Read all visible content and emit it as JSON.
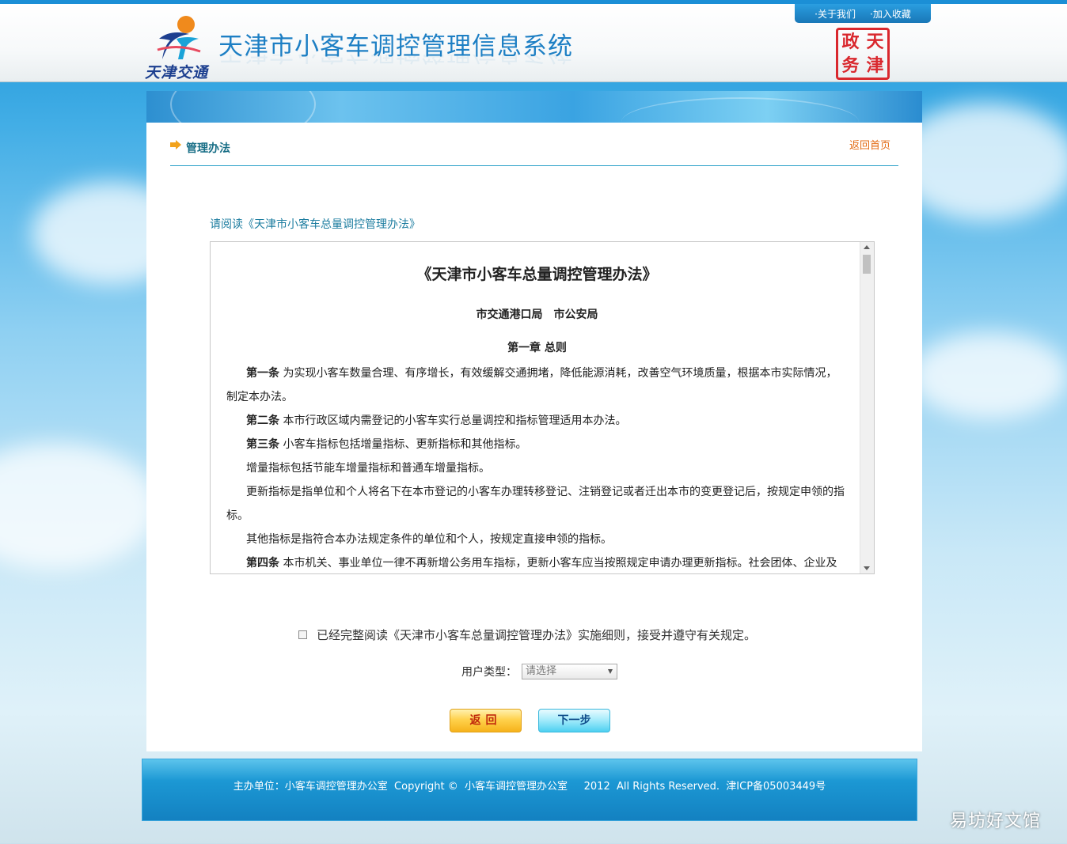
{
  "header": {
    "logo_sub": "天津交通",
    "site_title": "天津市小客车调控管理信息系统",
    "top_links": [
      "·关于我们",
      "·加入收藏"
    ],
    "seal_chars": [
      "天",
      "津",
      "政",
      "务"
    ]
  },
  "section": {
    "title": "管理办法",
    "back_home": "返回首页"
  },
  "read_hint": "请阅读《天津市小客车总量调控管理办法》",
  "document": {
    "title": "《天津市小客车总量调控管理办法》",
    "authors": "市交通港口局　市公安局",
    "chapter": "第一章  总则",
    "paragraphs": [
      {
        "lead": "第一条",
        "text": " 为实现小客车数量合理、有序增长，有效缓解交通拥堵，降低能源消耗，改善空气环境质量，根据本市实际情况，制定本办法。"
      },
      {
        "lead": "第二条",
        "text": " 本市行政区域内需登记的小客车实行总量调控和指标管理适用本办法。"
      },
      {
        "lead": "第三条",
        "text": " 小客车指标包括增量指标、更新指标和其他指标。"
      },
      {
        "lead": "",
        "text": "增量指标包括节能车增量指标和普通车增量指标。"
      },
      {
        "lead": "",
        "text": "更新指标是指单位和个人将名下在本市登记的小客车办理转移登记、注销登记或者迁出本市的变更登记后，按规定申领的指标。"
      },
      {
        "lead": "",
        "text": "其他指标是指符合本办法规定条件的单位和个人，按规定直接申领的指标。"
      },
      {
        "lead": "第四条",
        "text": " 本市机关、事业单位一律不再新增公务用车指标，更新小客车应当按照规定申请办理更新指标。社会团体、企业及"
      }
    ]
  },
  "agree_text": "已经完整阅读《天津市小客车总量调控管理办法》实施细则，接受并遵守有关规定。",
  "agree_checked": false,
  "user_type": {
    "label": "用户类型：",
    "selected": "请选择"
  },
  "buttons": {
    "back": "返回",
    "next": "下一步"
  },
  "footer": {
    "text": "主办单位：小客车调控管理办公室  Copyright ©  小客车调控管理办公室     2012  All Rights Reserved.  津ICP备05003449号"
  },
  "watermark": "易坊好文馆",
  "colors": {
    "accent_blue": "#1d7fc4",
    "section_teal": "#186e86",
    "link_orange": "#e36a12",
    "seal_red": "#d9282e"
  }
}
